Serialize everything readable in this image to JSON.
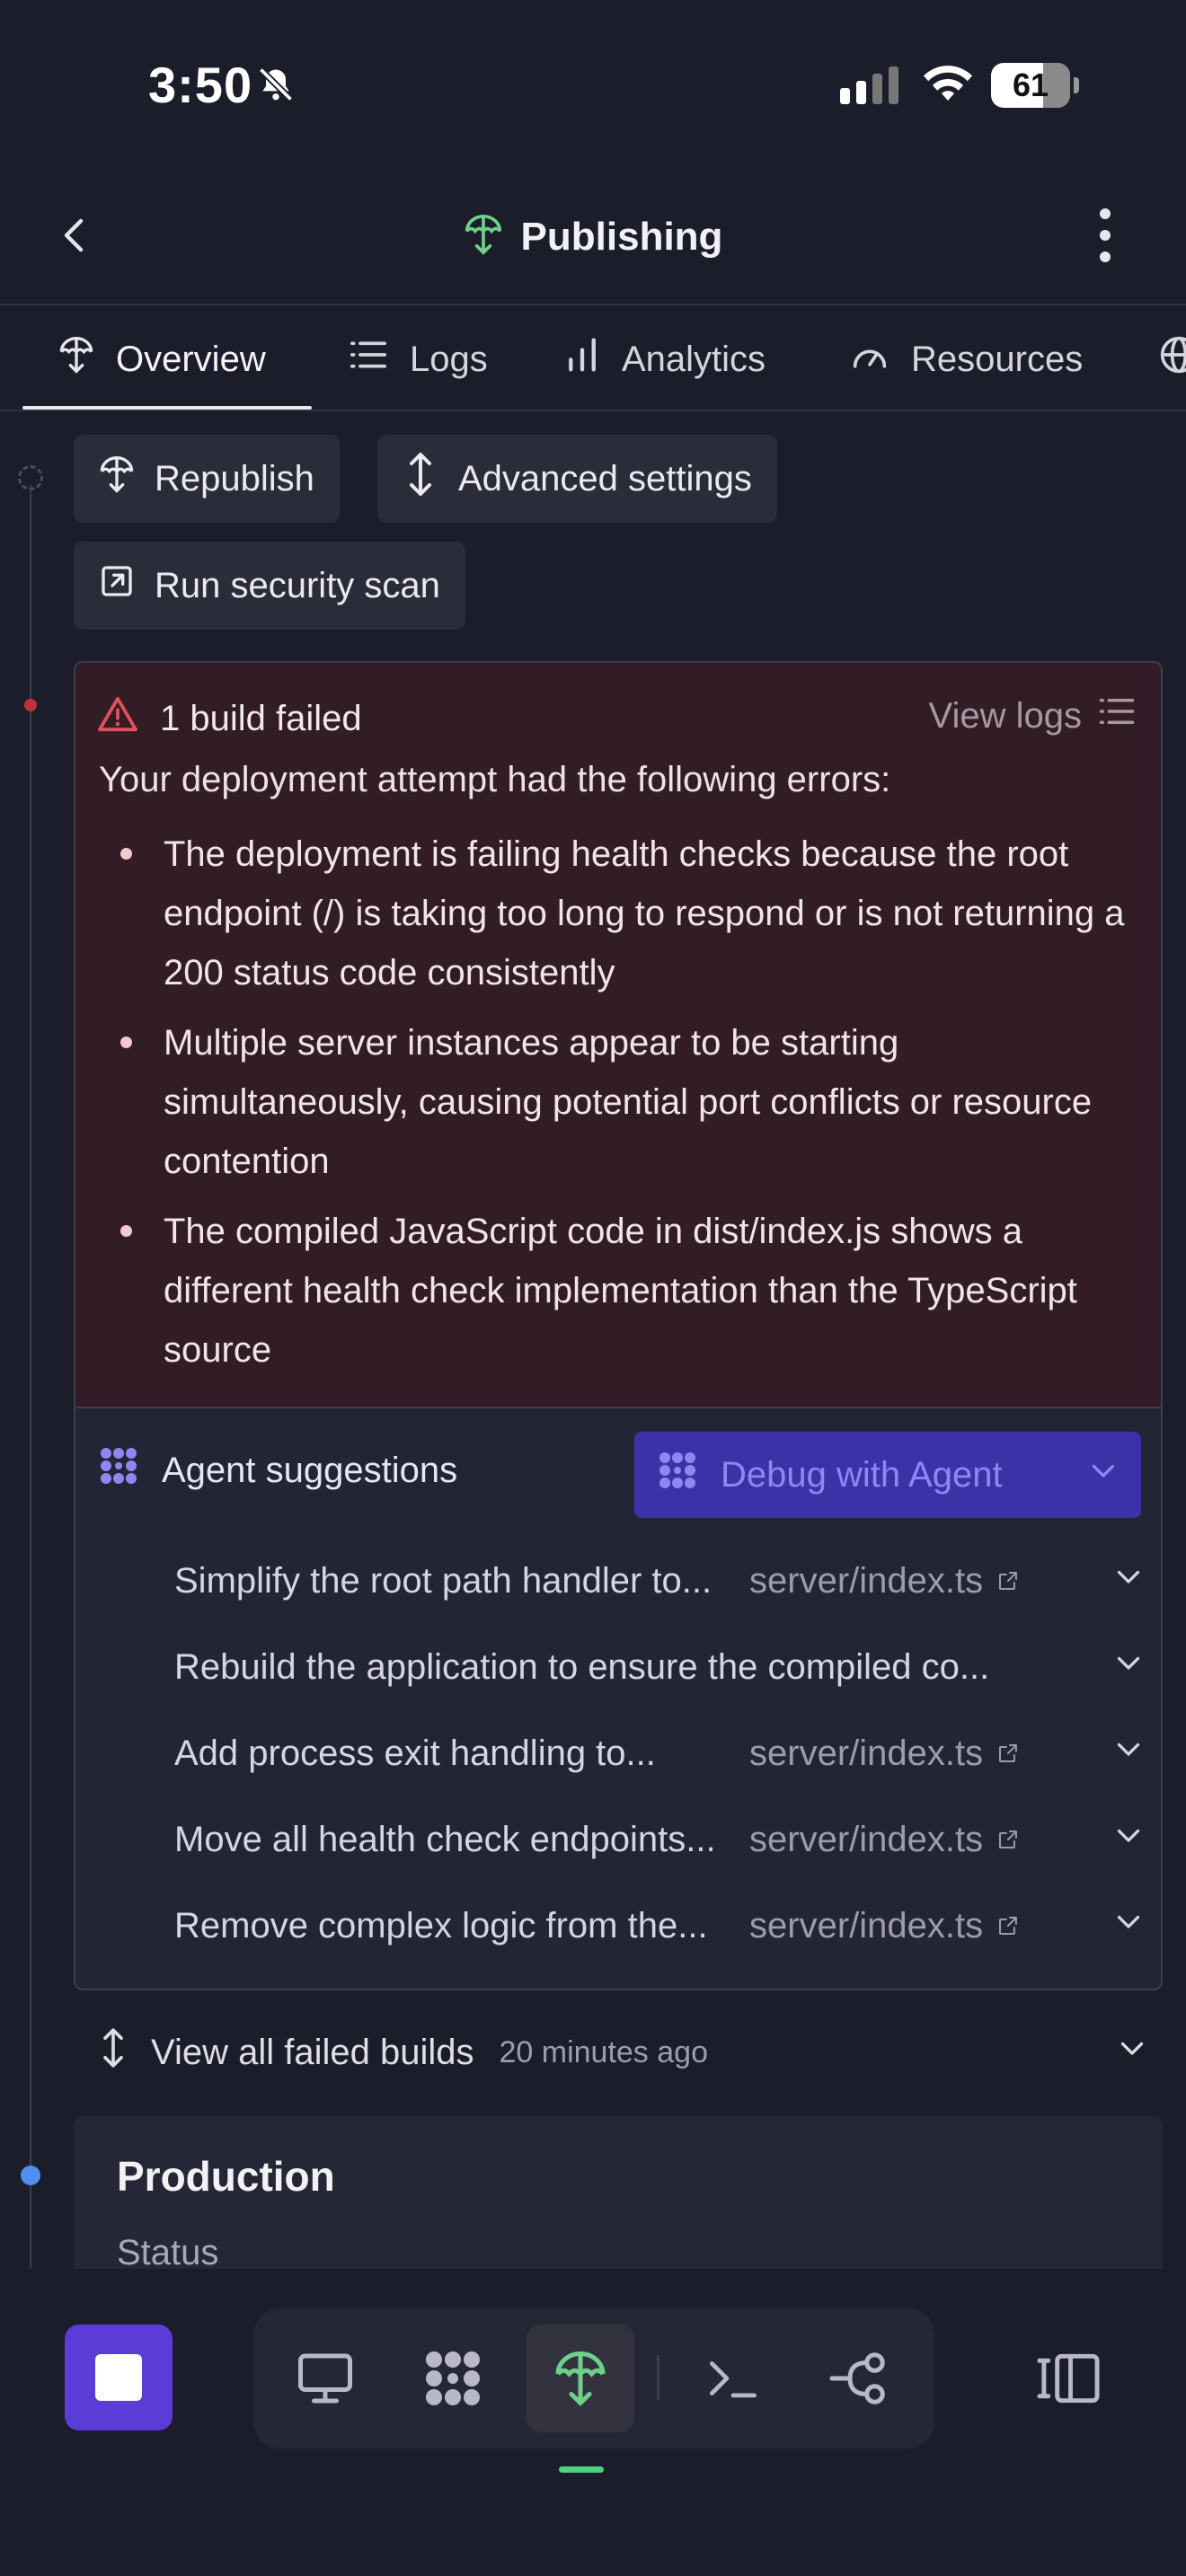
{
  "status_bar": {
    "time": "3:50",
    "battery": "61",
    "icons": [
      "bell-slash-icon",
      "cellular-signal-icon",
      "wifi-icon",
      "battery-icon"
    ]
  },
  "header": {
    "title": "Publishing",
    "back_icon": "chevron-left-icon",
    "menu_icon": "more-vertical-icon",
    "accent": "#6fd08c"
  },
  "tabs": [
    {
      "label": "Overview",
      "icon": "publish-icon",
      "active": true
    },
    {
      "label": "Logs",
      "icon": "list-icon"
    },
    {
      "label": "Analytics",
      "icon": "bar-chart-icon"
    },
    {
      "label": "Resources",
      "icon": "gauge-icon"
    }
  ],
  "actions": {
    "republish": "Republish",
    "advanced_settings": "Advanced settings",
    "run_security_scan": "Run security scan"
  },
  "build_error": {
    "title": "1 build failed",
    "view_logs": "View logs",
    "intro": "Your deployment attempt had the following errors:",
    "errors": [
      "The deployment is failing health checks because the root endpoint (/) is taking too long to respond or is not returning a 200 status code consistently",
      "Multiple server instances appear to be starting simultaneously, causing potential port conflicts or resource contention",
      "The compiled JavaScript code in dist/index.js shows a different health check implementation than the TypeScript source"
    ],
    "error_color": "#e0515c"
  },
  "suggestions": {
    "title": "Agent suggestions",
    "debug_button": "Debug with Agent",
    "accent": "#8f86f3",
    "items": [
      {
        "text": "Simplify the root path handler to...",
        "file": "server/index.ts"
      },
      {
        "text": "Rebuild the application to ensure the compiled co...",
        "file": ""
      },
      {
        "text": "Add process exit handling to...",
        "file": "server/index.ts"
      },
      {
        "text": "Move all health check endpoints...",
        "file": "server/index.ts"
      },
      {
        "text": "Remove complex logic from the...",
        "file": "server/index.ts"
      }
    ]
  },
  "failed_builds": {
    "label": "View all failed builds",
    "time_ago": "20 minutes ago"
  },
  "production": {
    "title": "Production",
    "status_label": "Status"
  },
  "dock": {
    "items": [
      "stop-icon",
      "desktop-icon",
      "agent-icon",
      "publish-icon",
      "terminal-icon",
      "git-icon",
      "panel-icon"
    ],
    "active": "publish-icon"
  }
}
